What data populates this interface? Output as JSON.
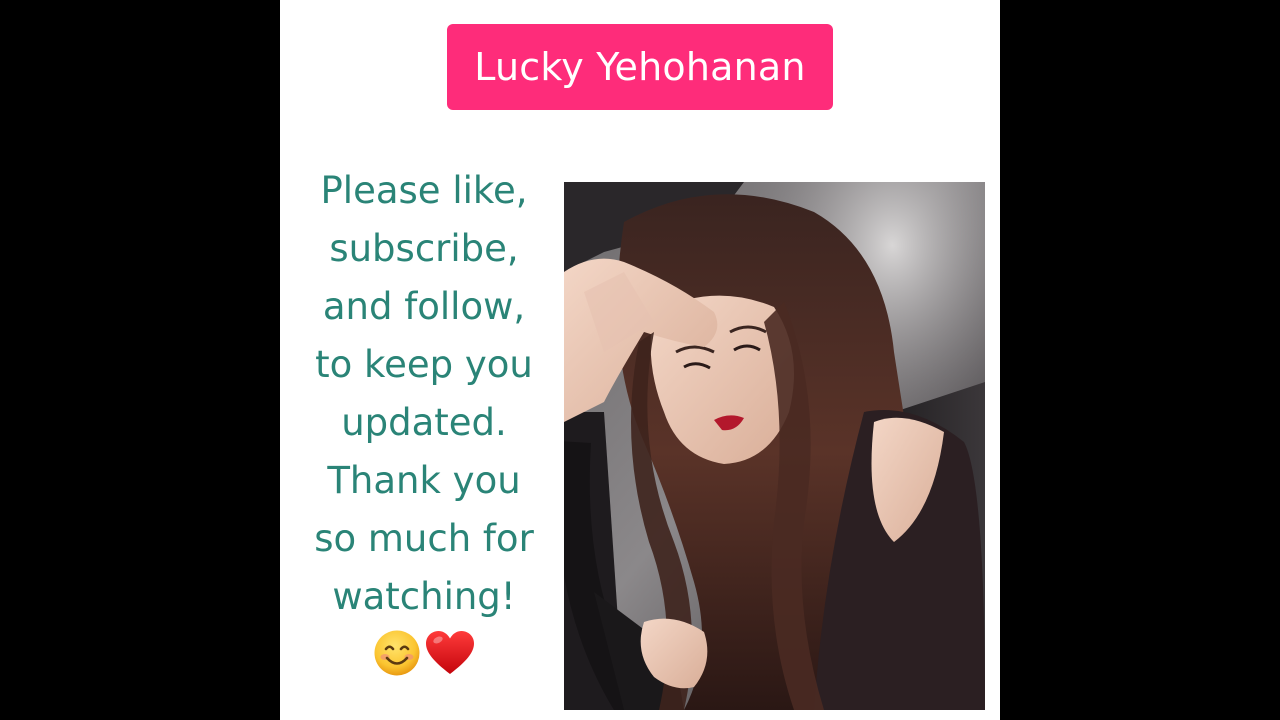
{
  "header": {
    "title": "Lucky Yehohanan",
    "badge_color": "#fe2c7a"
  },
  "message": {
    "lines": [
      "Please like,",
      "subscribe,",
      "and follow,",
      "to keep you",
      "updated.",
      "Thank you",
      "so much for",
      "watching!"
    ],
    "emojis": [
      "smiling-face-icon",
      "red-heart-icon"
    ],
    "text_color": "#2a8477"
  },
  "photo": {
    "subject": "woman-portrait-in-car"
  },
  "colors": {
    "background": "#000000",
    "canvas": "#ffffff"
  }
}
